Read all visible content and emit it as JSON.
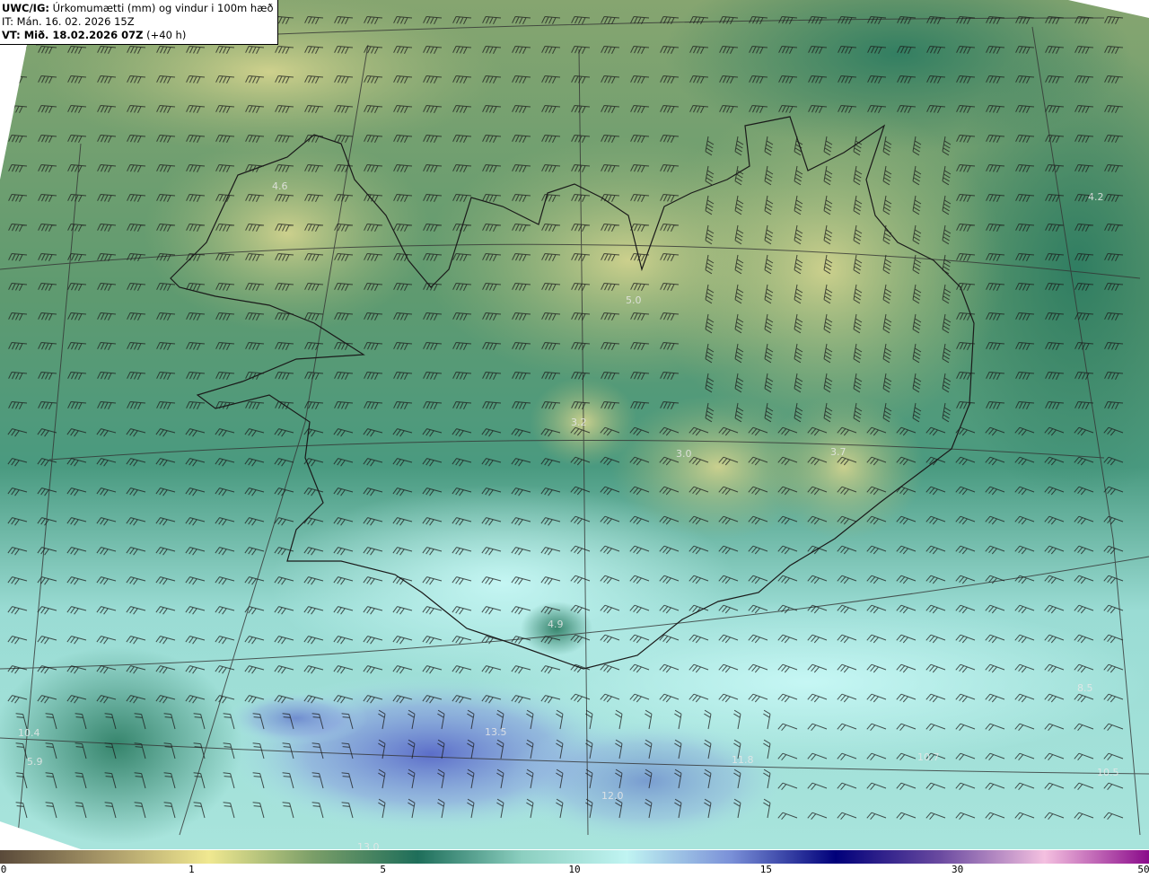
{
  "header": {
    "model": "UWC/IG:",
    "title": "Úrkomumætti (mm) og vindur i 100m hæð",
    "initial_time": "IT: Mán. 16. 02. 2026 15Z",
    "valid_label": "VT: Mið. 18.02.2026 07Z",
    "lead": "(+40 h)"
  },
  "map_values": [
    "4.6",
    "5.0",
    "4.2",
    "3.2",
    "3.0",
    "3.7",
    "4.9",
    "13.5",
    "13.0",
    "5.9",
    "10.4",
    "10.7",
    "10.5",
    "8.5",
    "12.0",
    "11.8"
  ],
  "colorbar": {
    "ticks": [
      "0",
      "1",
      "5",
      "10",
      "15",
      "30",
      "50"
    ],
    "colors": [
      "#5a4a3a",
      "#a89868",
      "#f0e890",
      "#7a9e68",
      "#1e6e5a",
      "#8ccfc0",
      "#c0f4f2",
      "#7a90d8",
      "#00007a",
      "#6a4aa0",
      "#f4c0e0",
      "#8a0a8a"
    ]
  }
}
